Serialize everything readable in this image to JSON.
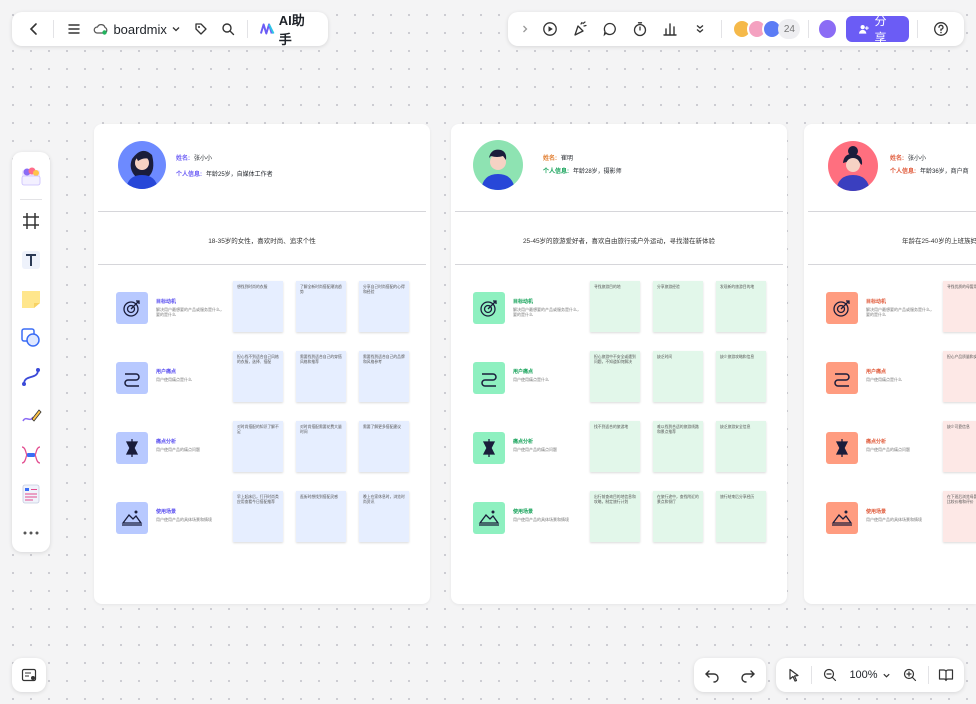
{
  "app": {
    "name": "boardmix",
    "ai_label": "AI助手",
    "share_label": "分享",
    "collaborator_count": "24",
    "zoom_level": "100%"
  },
  "colors": {
    "accent": "#6b5cf5",
    "blue_note": "#e6eeff",
    "blue_icon": "#b8c9ff",
    "green_note": "#e2f7ea",
    "green_icon": "#8ef0c0",
    "red_note": "#fde8e6",
    "red_icon": "#ff9c80"
  },
  "toolbar_left": {
    "icons": [
      "back-icon",
      "menu-icon",
      "cloud-icon",
      "chevron-down-icon",
      "tag-icon",
      "search-icon",
      "ai-logo-icon"
    ]
  },
  "toolbar_right": {
    "icons": [
      "chevron-right-icon",
      "present-icon",
      "celebrate-icon",
      "comment-icon",
      "timer-icon",
      "vote-icon",
      "more-chevron-icon",
      "help-icon"
    ]
  },
  "left_tools": [
    "template-icon",
    "frame-icon",
    "text-icon",
    "sticky-note-icon",
    "shape-icon",
    "connector-icon",
    "pen-icon",
    "mindmap-icon",
    "table-icon",
    "more-icon"
  ],
  "personas": [
    {
      "name_key": "姓名:",
      "name_value": "张小小",
      "info_key": "个人信息:",
      "info_value": "年龄25岁，自媒体工作者",
      "summary": "18-35岁的女性，喜欢时尚、追求个性",
      "rows": [
        {
          "title": "目标动机",
          "desc": "解决用户最想要的产品或服务是什么，要的是什么",
          "notes": [
            "想找到时尚的衣服",
            "了解全新时尚搭配潮流趋势",
            "分享自己时尚搭配的心得和经验"
          ]
        },
        {
          "title": "用户痛点",
          "desc": "用户使用痛点是什么",
          "notes": [
            "担心找不到适合自己风格的衣服，选择、搭配",
            "需要找到适合自己的穿搭风格和推荐",
            "需要找到适合自己的品牌和风格参考"
          ]
        },
        {
          "title": "痛点分析",
          "desc": "用户使用产品的痛点问题",
          "notes": [
            "对时尚搭配的知识了解不足",
            "对时尚搭配需要花费大量时间",
            "需要了解更多搭配建议"
          ]
        },
        {
          "title": "使用场景",
          "desc": "用户使用产品的具体场景和情境",
          "notes": [
            "早上起床后，打开时尚类应用查看今日搭配推荐",
            "逛街时想找到搭配灵感",
            "晚上在家休息时，浏览时尚资讯"
          ]
        }
      ]
    },
    {
      "name_key": "姓名:",
      "name_value": "崔明",
      "info_key": "个人信息:",
      "info_value": "年龄28岁，摄影师",
      "summary": "25-45岁的旅游爱好者，喜欢自由旅行或户外运动，寻找潜在新体验",
      "rows": [
        {
          "title": "目标动机",
          "desc": "解决用户最想要的产品或服务是什么，要的是什么",
          "notes": [
            "寻找旅游目的地",
            "分享旅游经验",
            "发现新的旅游目的地"
          ]
        },
        {
          "title": "用户痛点",
          "desc": "用户使用痛点是什么",
          "notes": [
            "担心旅游中不安全或遇到问题，不知道如何解决",
            "缺乏时间",
            "缺少旅游攻略和信息"
          ]
        },
        {
          "title": "痛点分析",
          "desc": "用户使用产品的痛点问题",
          "notes": [
            "找不到适合的旅游地",
            "难以找到合适的旅游线路和景点推荐",
            "缺乏旅游安全信息"
          ]
        },
        {
          "title": "使用场景",
          "desc": "用户使用产品的具体场景和情境",
          "notes": [
            "出行前查询目的地信息和攻略，制定旅行计划",
            "在旅行途中，查找附近的景点和餐厅",
            "旅行结束后分享经历"
          ]
        }
      ]
    },
    {
      "name_key": "姓名:",
      "name_value": "张小小",
      "info_key": "个人信息:",
      "info_value": "年龄36岁，商户商",
      "summary": "年龄在25-40岁的上班族妈妈，",
      "rows": [
        {
          "title": "目标动机",
          "desc": "解决用户最想要的产品或服务是什么，要的是什么",
          "notes": [
            "寻找优质的母婴用品"
          ]
        },
        {
          "title": "用户痛点",
          "desc": "用户使用痛点是什么",
          "notes": [
            "担心产品质量和安全问题"
          ]
        },
        {
          "title": "痛点分析",
          "desc": "用户使用产品的痛点问题",
          "notes": [
            "缺少可靠信息"
          ]
        },
        {
          "title": "使用场景",
          "desc": "用户使用产品的具体场景和情境",
          "notes": [
            "在下班后浏览母婴用品，比较价格和评价"
          ]
        }
      ]
    }
  ]
}
